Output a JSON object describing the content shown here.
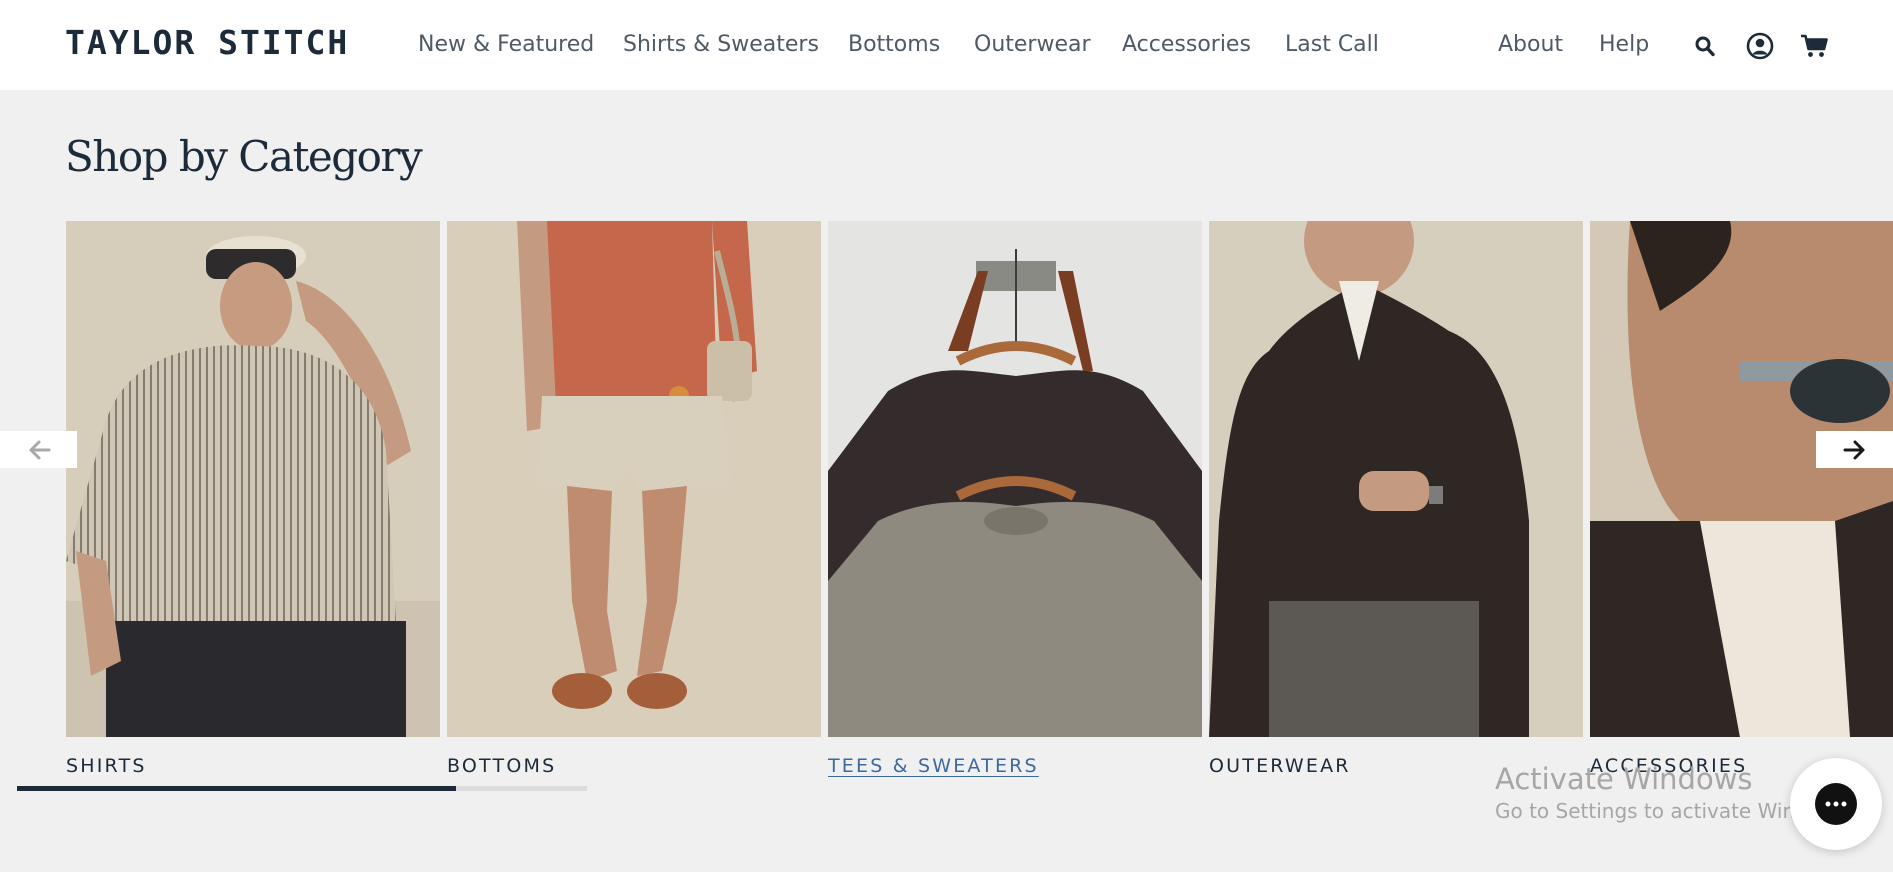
{
  "brand": {
    "name": "TAYLOR STITCH"
  },
  "nav": {
    "items": [
      {
        "label": "New & Featured"
      },
      {
        "label": "Shirts & Sweaters"
      },
      {
        "label": "Bottoms"
      },
      {
        "label": "Outerwear"
      },
      {
        "label": "Accessories"
      },
      {
        "label": "Last Call"
      }
    ],
    "utility": [
      {
        "label": "About"
      },
      {
        "label": "Help"
      }
    ]
  },
  "icons": {
    "search": "search-icon",
    "account": "account-icon",
    "cart": "cart-icon"
  },
  "section": {
    "title": "Shop by Category"
  },
  "categories": [
    {
      "label": "SHIRTS"
    },
    {
      "label": "BOTTOMS"
    },
    {
      "label": "TEES & SWEATERS",
      "active": true
    },
    {
      "label": "OUTERWEAR"
    },
    {
      "label": "ACCESSORIES"
    }
  ],
  "carousel": {
    "progress_fraction": 0.77
  },
  "watermark": {
    "title": "Activate Windows",
    "subtitle": "Go to Settings to activate Windows."
  },
  "colors": {
    "brand_navy": "#1c2a3a",
    "link_active": "#3d6a9e",
    "background": "#f0f0f0"
  }
}
